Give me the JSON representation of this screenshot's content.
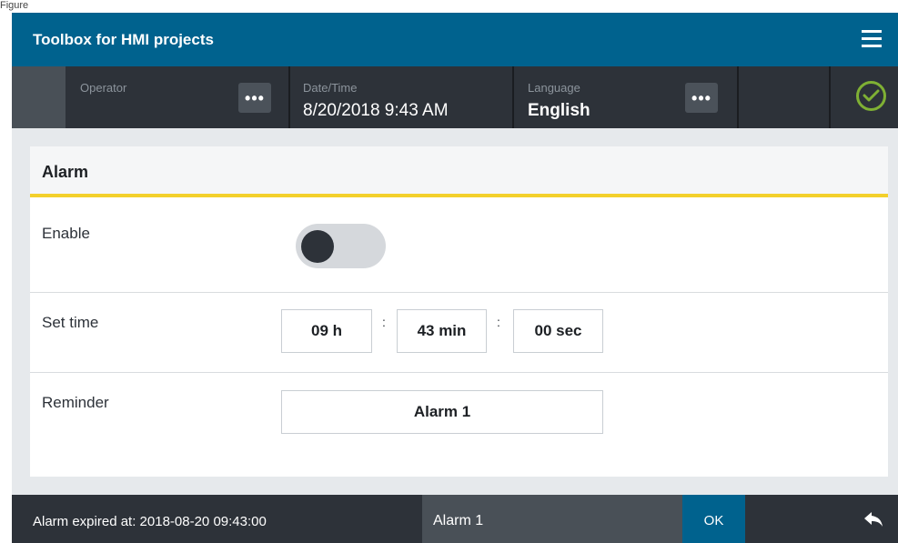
{
  "caption": "Figure",
  "app": {
    "title": "Toolbox for HMI projects"
  },
  "statusbar": {
    "operator": {
      "label": "Operator",
      "value": ""
    },
    "datetime": {
      "label": "Date/Time",
      "value": "8/20/2018 9:43 AM"
    },
    "language": {
      "label": "Language",
      "value": "English"
    },
    "more_symbol": "•••",
    "status_color": "#7fb034"
  },
  "panel": {
    "title": "Alarm",
    "accent_color": "#f3d02b",
    "enable": {
      "label": "Enable",
      "state": "off"
    },
    "set_time": {
      "label": "Set time",
      "hours": "09 h",
      "minutes": "43 min",
      "seconds": "00 sec",
      "separator": ":"
    },
    "reminder": {
      "label": "Reminder",
      "value": "Alarm 1"
    }
  },
  "footer": {
    "message": "Alarm expired at: 2018-08-20 09:43:00",
    "alarm_name": "Alarm 1",
    "ok_label": "OK",
    "back_icon": "back-arrow-icon"
  },
  "colors": {
    "brand": "#00628e",
    "dark": "#2d3239"
  }
}
